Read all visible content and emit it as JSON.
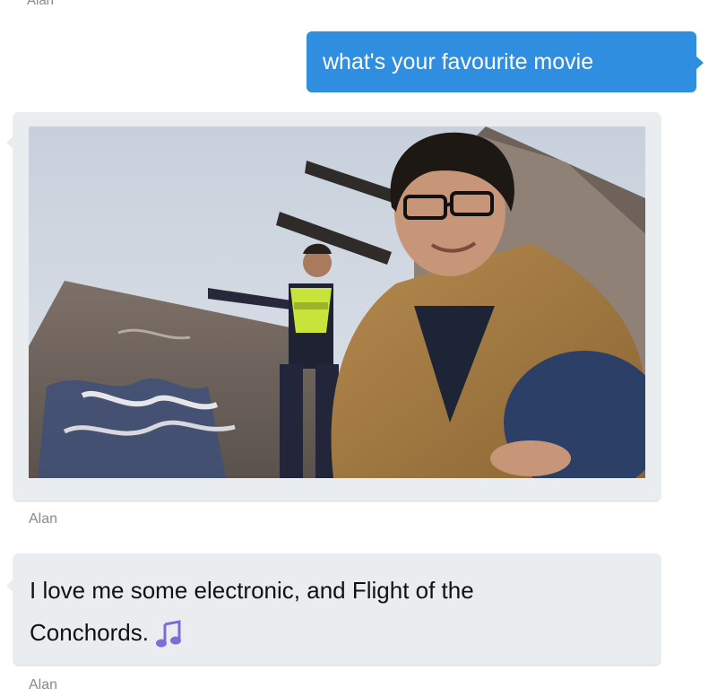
{
  "messages": [
    {
      "sender": "Alan",
      "partial": true
    },
    {
      "direction": "outgoing",
      "text": "what's your favourite movie"
    },
    {
      "direction": "incoming",
      "type": "image",
      "sender": "Alan"
    },
    {
      "direction": "incoming",
      "type": "text",
      "text_line1": "I love me some electronic, and Flight of the",
      "text_line2": "Conchords.",
      "icon": "music-note-icon",
      "sender": "Alan"
    }
  ],
  "colors": {
    "outgoing_bubble": "#2f8ee0",
    "incoming_bubble": "#e9edf0",
    "sender_label": "#8a8a8a",
    "music_note": "#7b6fd6"
  }
}
